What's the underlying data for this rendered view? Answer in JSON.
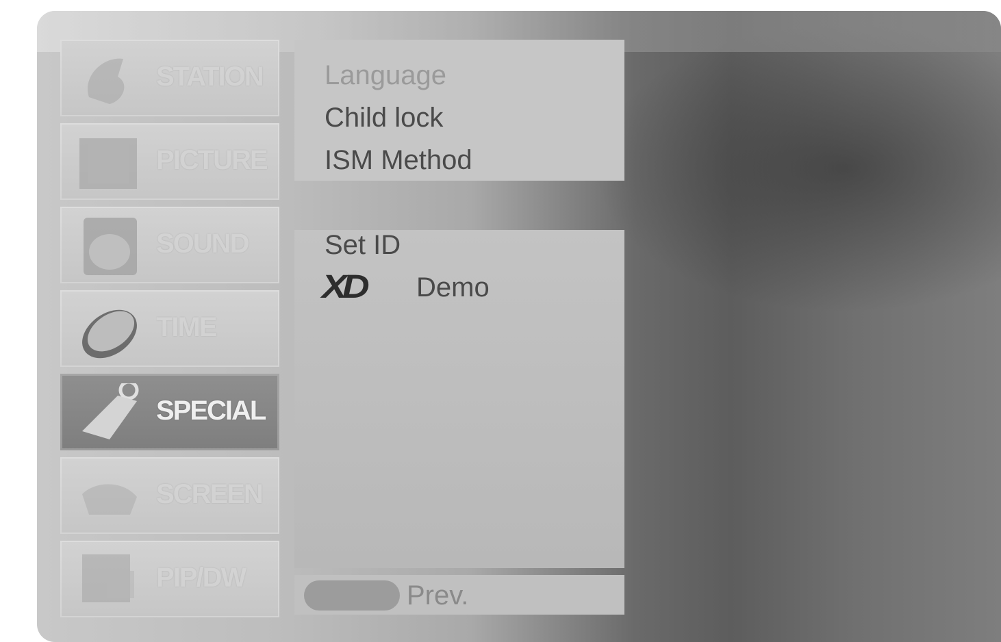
{
  "sidebar": {
    "items": [
      {
        "label": "STATION",
        "icon": "globe-icon",
        "state": "dim"
      },
      {
        "label": "PICTURE",
        "icon": "picture-frame-icon",
        "state": "dim"
      },
      {
        "label": "SOUND",
        "icon": "speaker-icon",
        "state": "dim"
      },
      {
        "label": "TIME",
        "icon": "clock-icon",
        "state": "dim"
      },
      {
        "label": "SPECIAL",
        "icon": "tag-icon",
        "state": "active"
      },
      {
        "label": "SCREEN",
        "icon": "monitor-icon",
        "state": "dim"
      },
      {
        "label": "PIP/DW",
        "icon": "pip-window-icon",
        "state": "dim"
      }
    ]
  },
  "submenu": {
    "top_items": [
      "Language",
      "Child lock",
      "ISM Method"
    ],
    "set_id": "Set ID",
    "xd_logo": "XD",
    "xd_demo": "Demo"
  },
  "footer": {
    "prev_label": "Prev."
  },
  "colors": {
    "panel": "#c6c6c6",
    "active_item": "#858585",
    "text": "#4a4a4a"
  }
}
